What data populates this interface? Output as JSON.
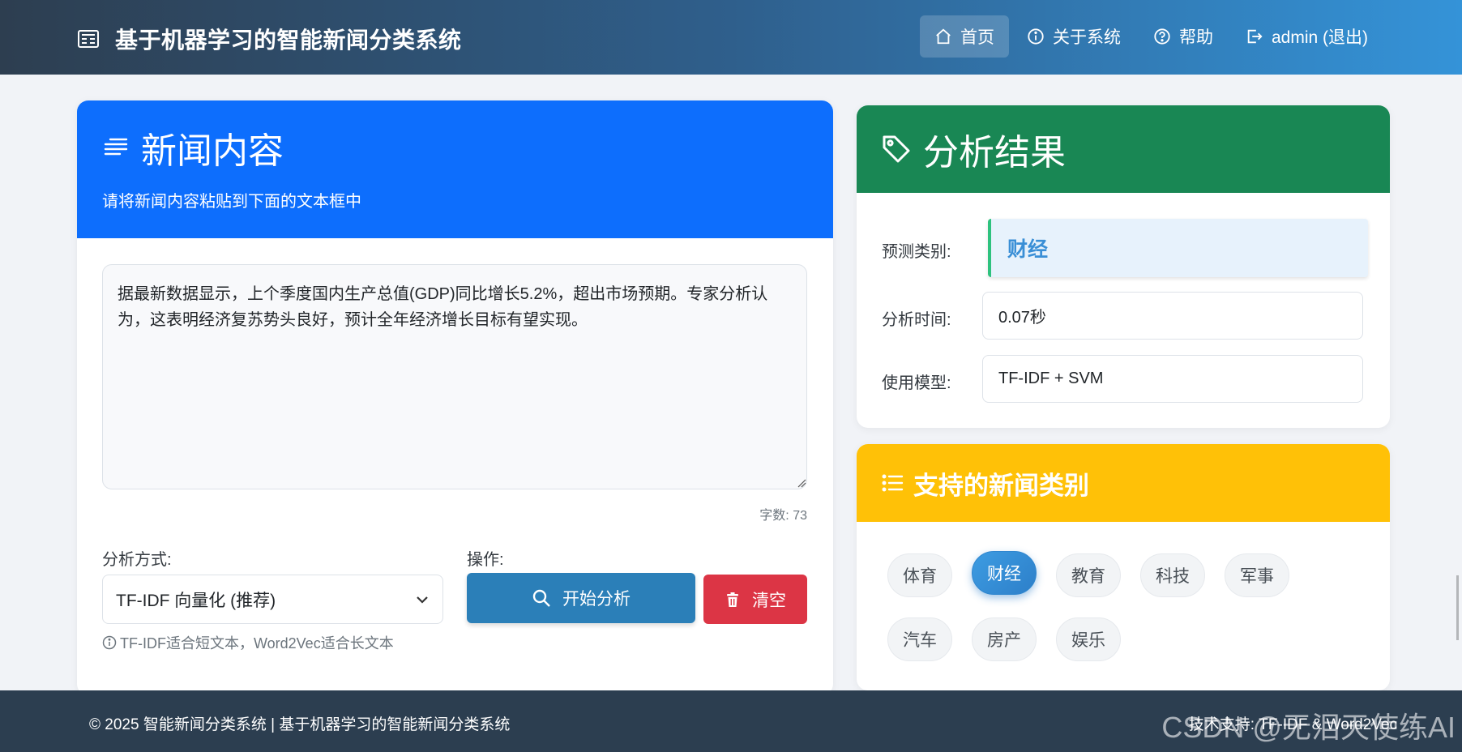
{
  "navbar": {
    "brand": "基于机器学习的智能新闻分类系统",
    "items": [
      {
        "label": "首页",
        "icon": "home-icon",
        "active": true
      },
      {
        "label": "关于系统",
        "icon": "info-icon"
      },
      {
        "label": "帮助",
        "icon": "help-icon"
      },
      {
        "label": "admin (退出)",
        "icon": "logout-icon"
      }
    ]
  },
  "news": {
    "title": "新闻内容",
    "subtitle": "请将新闻内容粘贴到下面的文本框中",
    "text": "据最新数据显示，上个季度国内生产总值(GDP)同比增长5.2%，超出市场预期。专家分析认为，这表明经济复苏势头良好，预计全年经济增长目标有望实现。",
    "char_count": "字数: 73",
    "method_label": "分析方式:",
    "method_value": "TF-IDF 向量化 (推荐)",
    "method_hint": "TF-IDF适合短文本，Word2Vec适合长文本",
    "action_label": "操作:",
    "analyze_button": "开始分析",
    "clear_button": "清空"
  },
  "result": {
    "title": "分析结果",
    "predicted_label": "预测类别:",
    "predicted_value": "财经",
    "time_label": "分析时间:",
    "time_value": "0.07秒",
    "model_label": "使用模型:",
    "model_value": "TF-IDF + SVM"
  },
  "categories": {
    "title": "支持的新闻类别",
    "items": [
      "体育",
      "财经",
      "教育",
      "科技",
      "军事",
      "汽车",
      "房产",
      "娱乐"
    ],
    "active": "财经"
  },
  "footer": {
    "copyright": "© 2025 智能新闻分类系统 | 基于机器学习的智能新闻分类系统",
    "tech": "技术支持: TF-IDF & Word2Vec",
    "watermark": "CSDN @无泪天使练AI"
  },
  "colors": {
    "primary": "#0d6efd",
    "success": "#198754",
    "warning": "#ffc107",
    "danger": "#dc3545",
    "analyze": "#2b7fb8",
    "navbar_start": "#2d3e50",
    "navbar_end": "#3493d8",
    "footer": "#2c3e50"
  }
}
